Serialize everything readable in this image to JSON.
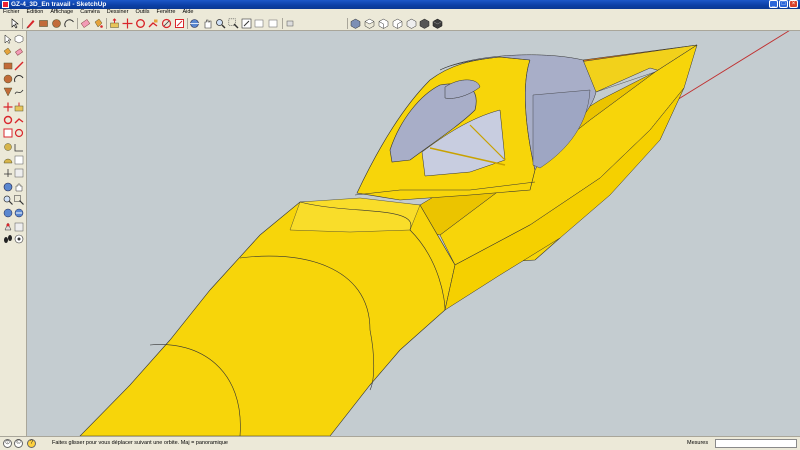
{
  "window": {
    "title": "GZ-4_3D_En travail - SketchUp"
  },
  "menu": {
    "items": [
      "Fichier",
      "Edition",
      "Affichage",
      "Caméra",
      "Dessiner",
      "Outils",
      "Fenêtre",
      "Aide"
    ]
  },
  "toolbar": {
    "icons": [
      "select-icon",
      "pencil-icon",
      "rectangle-icon",
      "circle-icon",
      "arc-icon",
      "eraser-icon",
      "paint-bucket-icon",
      "push-pull-icon",
      "move-icon",
      "rotate-icon",
      "follow-me-icon",
      "offset-icon",
      "orbit-icon",
      "pan-icon",
      "zoom-icon",
      "zoom-window-icon",
      "zoom-extents-icon",
      "previous-view-icon",
      "next-view-icon",
      "position-camera-icon",
      "walk-icon",
      "look-around-icon",
      "iso-view-icon",
      "top-view-icon",
      "front-view-icon",
      "right-view-icon",
      "back-view-icon",
      "left-view-icon",
      "shaded-icon"
    ]
  },
  "left_toolbar": {
    "icons": [
      "select-icon",
      "component-icon",
      "paint-icon",
      "eraser-icon",
      "rectangle-icon",
      "line-icon",
      "circle-icon",
      "arc-icon",
      "polygon-icon",
      "freehand-icon",
      "move-icon",
      "push-pull-icon",
      "rotate-icon",
      "follow-me-icon",
      "scale-icon",
      "offset-icon",
      "tape-measure-icon",
      "dimension-icon",
      "protractor-icon",
      "text-icon",
      "axes-icon",
      "3d-text-icon",
      "orbit-icon",
      "pan-icon",
      "zoom-icon",
      "zoom-window-icon",
      "zoom-extents-icon",
      "previous-view-icon",
      "position-camera-icon",
      "walk-icon",
      "look-around-icon",
      "section-plane-icon"
    ]
  },
  "status": {
    "hint": "Faites glisser pour vous déplacer suivant une orbite. Maj = panoramique",
    "measures_label": "Mesures",
    "measures_value": ""
  },
  "colors": {
    "viewport_bg": "#c4ccd0",
    "model_yellow": "#f7d50a",
    "canopy_glass": "#a8aec8",
    "nose_orange": "#e87f12",
    "axis_red": "#c03030"
  }
}
